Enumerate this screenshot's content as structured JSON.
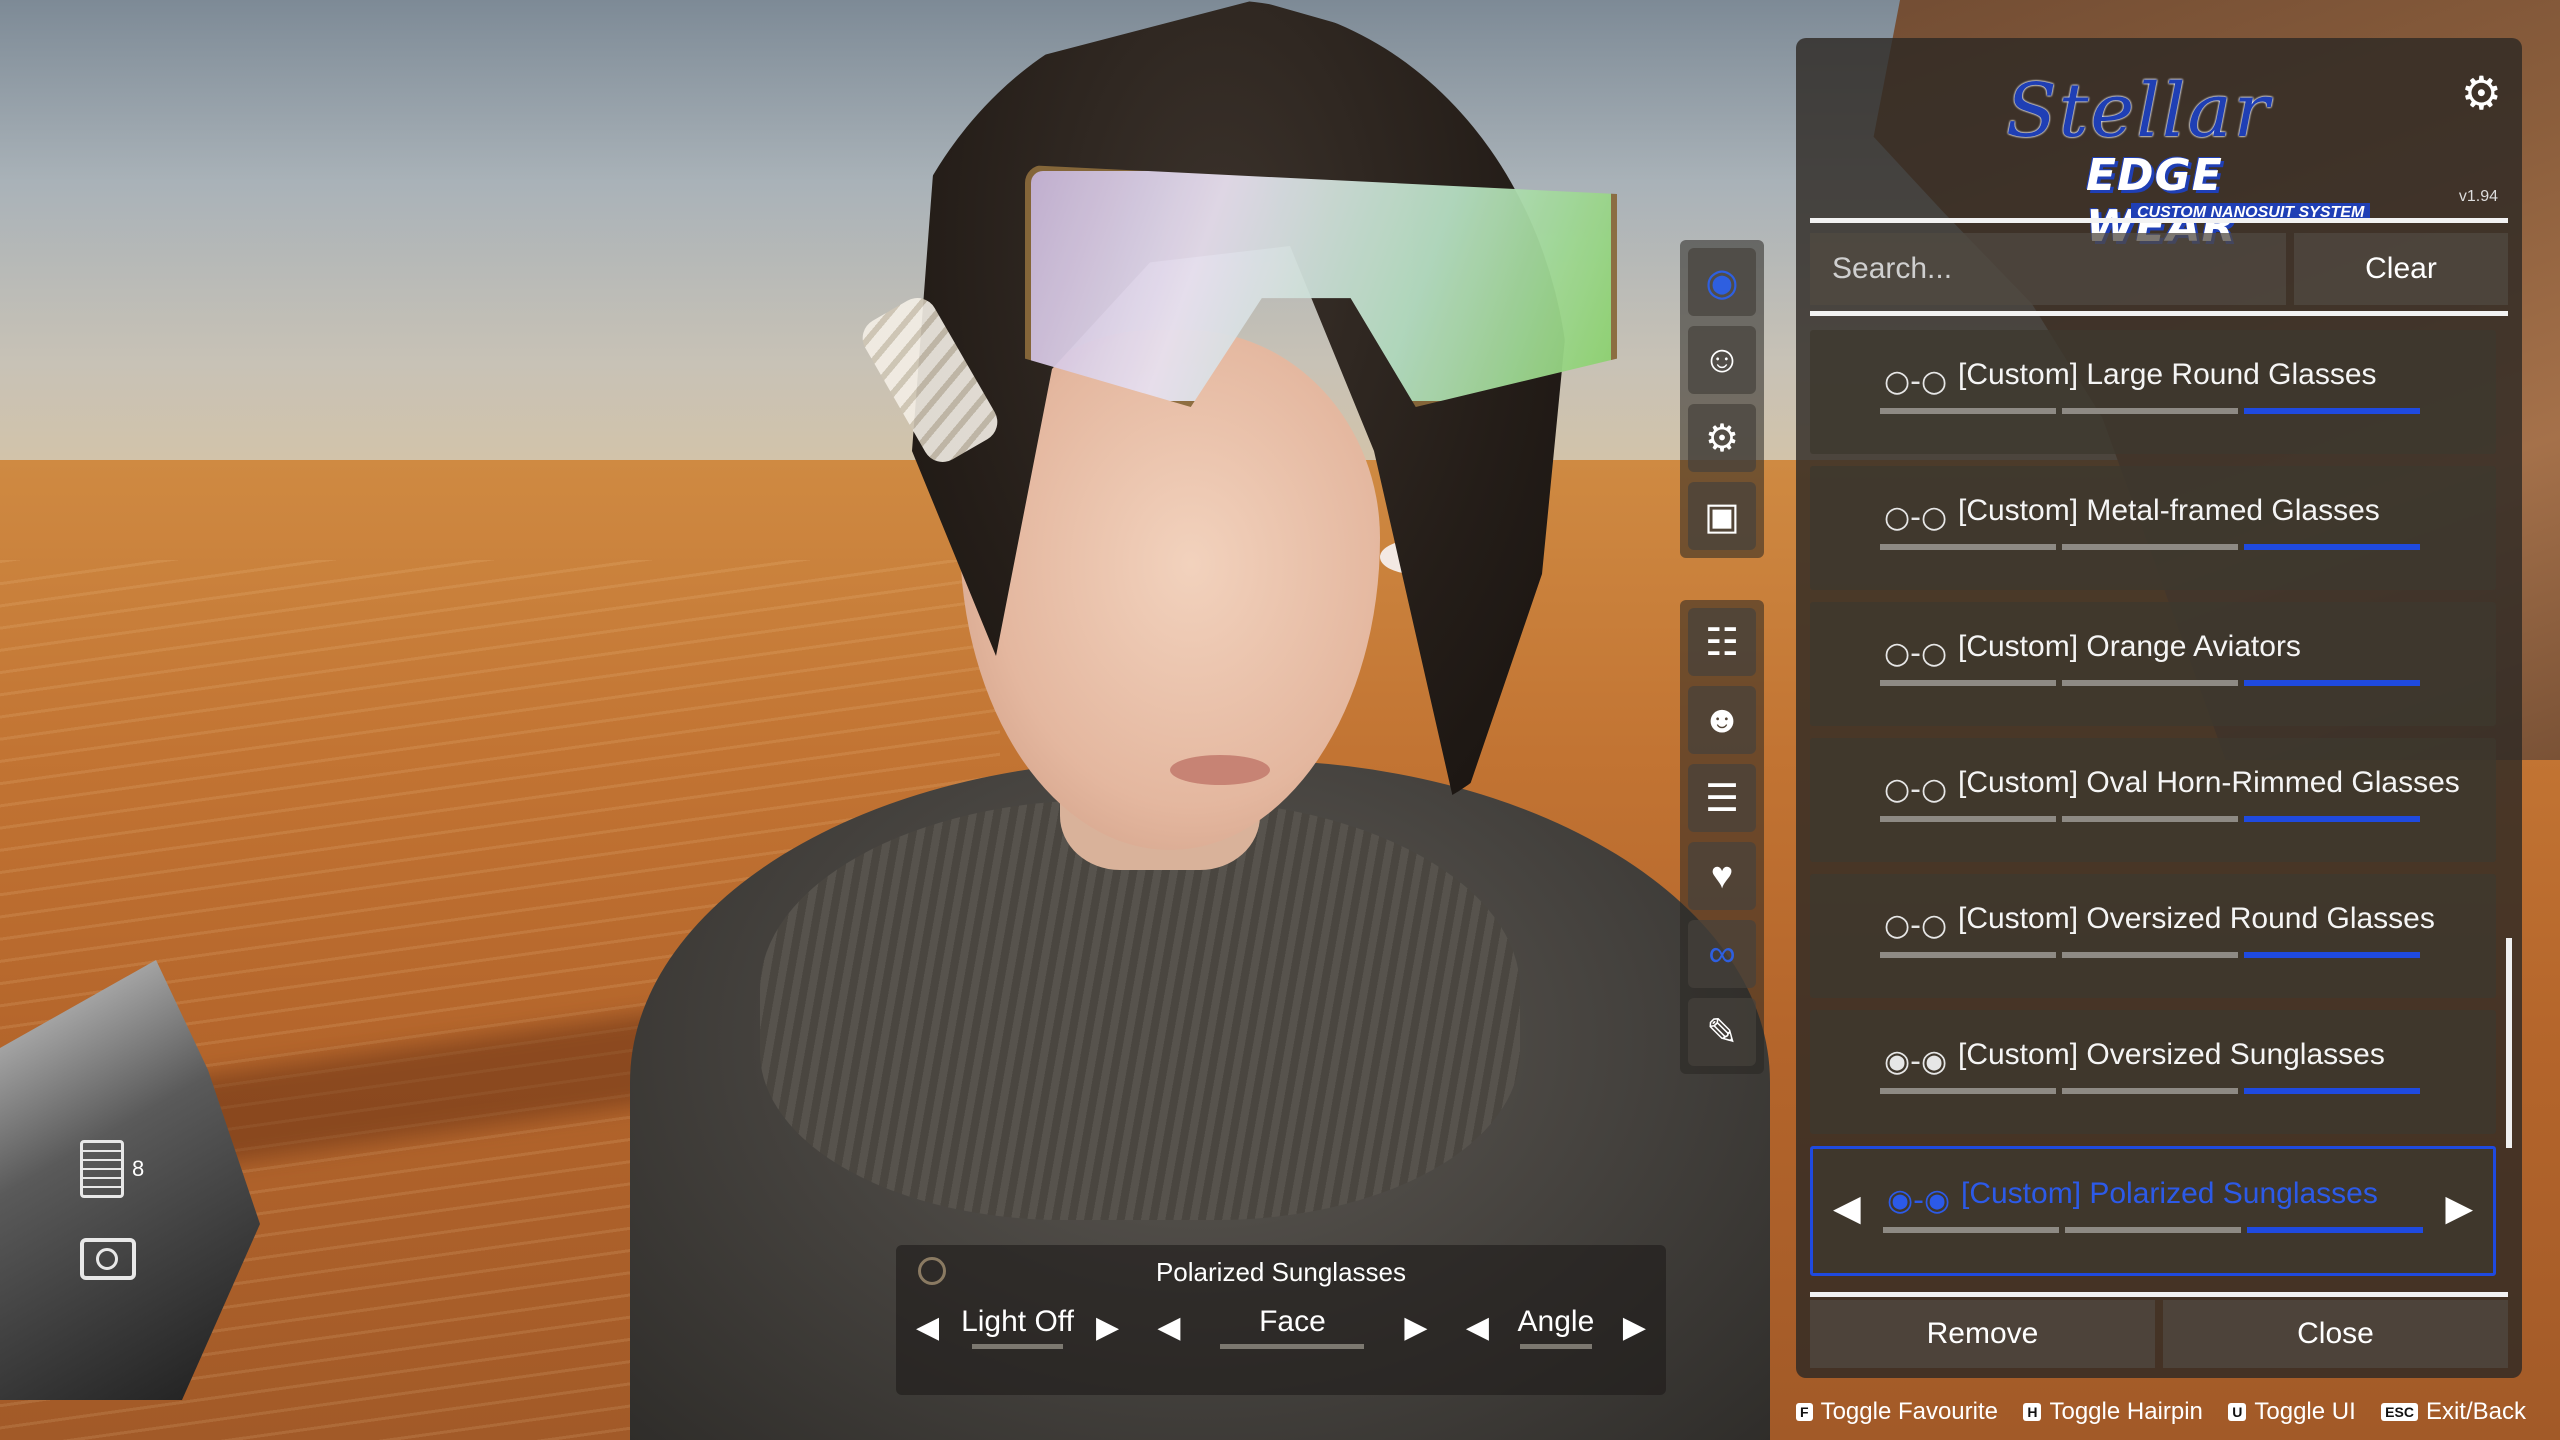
{
  "panel": {
    "logo_script": "Stellar",
    "logo_main": "EDGE WEAR",
    "logo_sub": "CUSTOM NANOSUIT SYSTEM",
    "version": "v1.94",
    "settings_icon": "gear-icon",
    "search_placeholder": "Search...",
    "clear_label": "Clear",
    "items": [
      {
        "icon": "glasses-icon",
        "label": "[Custom] Large Round Glasses",
        "selected": false,
        "level": 3
      },
      {
        "icon": "glasses-icon",
        "label": "[Custom] Metal-framed Glasses",
        "selected": false,
        "level": 3
      },
      {
        "icon": "glasses-icon",
        "label": "[Custom] Orange Aviators",
        "selected": false,
        "level": 3
      },
      {
        "icon": "glasses-icon",
        "label": "[Custom] Oval Horn-Rimmed Glasses",
        "selected": false,
        "level": 3
      },
      {
        "icon": "glasses-icon",
        "label": "[Custom] Oversized Round Glasses",
        "selected": false,
        "level": 3
      },
      {
        "icon": "sunglasses-icon",
        "label": "[Custom] Oversized Sunglasses",
        "selected": false,
        "level": 3
      },
      {
        "icon": "sunglasses-icon",
        "label": "[Custom] Polarized Sunglasses",
        "selected": true,
        "level": 3
      }
    ],
    "remove_label": "Remove",
    "close_label": "Close"
  },
  "categories_top": [
    "hair-icon",
    "face-icon",
    "head-gear-icon",
    "mask-icon"
  ],
  "categories_bottom": [
    "outfit-icon",
    "eyes-icon",
    "comb-icon",
    "earrings-icon",
    "glasses-icon",
    "brush-icon"
  ],
  "hints": [
    {
      "key": "F",
      "label": "Toggle Favourite"
    },
    {
      "key": "H",
      "label": "Toggle Hairpin"
    },
    {
      "key": "U",
      "label": "Toggle UI"
    },
    {
      "key": "ESC",
      "label": "Exit/Back"
    }
  ],
  "control": {
    "title": "Polarized Sunglasses",
    "light_label": "Light Off",
    "face_label": "Face",
    "angle_label": "Angle",
    "light_level": 0.5,
    "face_level": 1.0,
    "angle_level": 0.5
  },
  "hud": {
    "log_count": "8"
  },
  "colors": {
    "accent": "#1f4ae0",
    "panel_bg": "#2e2a24"
  }
}
